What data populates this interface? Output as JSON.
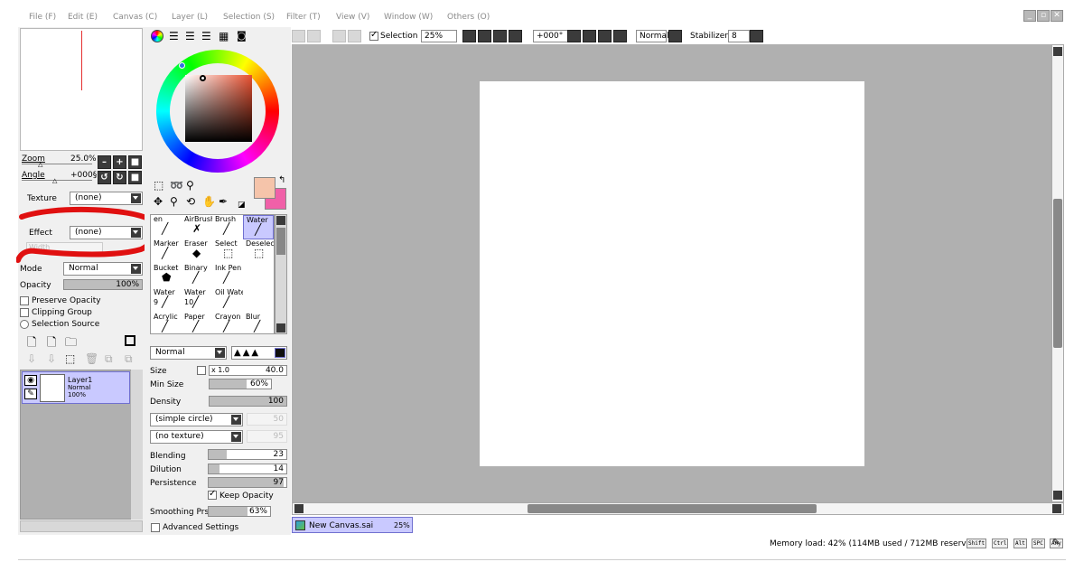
{
  "menu": {
    "file": "File (F)",
    "edit": "Edit (E)",
    "canvas": "Canvas (C)",
    "layer": "Layer (L)",
    "selection": "Selection (S)",
    "filter": "Filter (T)",
    "view": "View (V)",
    "window": "Window (W)",
    "others": "Others (O)"
  },
  "navigator": {
    "zoom_label": "Zoom",
    "zoom_value": "25.0%",
    "angle_label": "Angle",
    "angle_value": "+000§"
  },
  "layer_props": {
    "texture_label": "Texture",
    "texture_value": "(none)",
    "effect_label": "Effect",
    "effect_value": "(none)",
    "effect_sub": "Width",
    "mode_label": "Mode",
    "mode_value": "Normal",
    "opacity_label": "Opacity",
    "opacity_value": "100%",
    "opacity_level": 1.0,
    "preserve_opacity": "Preserve Opacity",
    "clipping_group": "Clipping Group",
    "selection_source": "Selection Source"
  },
  "layers": [
    {
      "name": "Layer1",
      "mode": "Normal",
      "opacity": "100%"
    }
  ],
  "colors": {
    "primary": "#f5c4aa",
    "secondary": "#f060a8",
    "highlight": "#e01010"
  },
  "tools": [
    {
      "name": "Pen",
      "label": "en"
    },
    {
      "name": "AirBrush",
      "label": "AirBrush"
    },
    {
      "name": "Brush",
      "label": "Brush"
    },
    {
      "name": "Water",
      "label": "Water"
    },
    {
      "name": "Marker",
      "label": "Marker"
    },
    {
      "name": "Eraser",
      "label": "Eraser"
    },
    {
      "name": "Select",
      "label": "Select"
    },
    {
      "name": "Deselect",
      "label": "Deselect"
    },
    {
      "name": "Bucket",
      "label": "Bucket"
    },
    {
      "name": "Binary",
      "label": "Binary"
    },
    {
      "name": "InkPen",
      "label": "Ink Pen"
    },
    {
      "name": "Empty",
      "label": ""
    },
    {
      "name": "Water9",
      "label": "Water"
    },
    {
      "name": "Water10",
      "label": "Water"
    },
    {
      "name": "OilWater",
      "label": "Oil Wate"
    },
    {
      "name": "Empty2",
      "label": ""
    },
    {
      "name": "Acrylic",
      "label": "Acrylic"
    },
    {
      "name": "Paper",
      "label": "Paper"
    },
    {
      "name": "Crayon",
      "label": "Crayon"
    },
    {
      "name": "Blur",
      "label": "Blur"
    }
  ],
  "tool_sub": {
    "water9": "9",
    "water10": "10"
  },
  "brush": {
    "blend_mode": "Normal",
    "size_label": "Size",
    "size_mult": "x 1.0",
    "size_value": "40.0",
    "min_size_label": "Min Size",
    "min_size_value": "60%",
    "min_size_level": 0.6,
    "density_label": "Density",
    "density_value": "100",
    "density_level": 1.0,
    "shape": "(simple circle)",
    "shape_value": "50",
    "texture": "(no texture)",
    "texture_value": "95",
    "blending_label": "Blending",
    "blending_value": "23",
    "blending_level": 0.23,
    "dilution_label": "Dilution",
    "dilution_value": "14",
    "dilution_level": 0.14,
    "persistence_label": "Persistence",
    "persistence_value": "97",
    "persistence_level": 0.97,
    "keep_opacity": "Keep Opacity",
    "smoothing_label": "Smoothing Prs",
    "smoothing_value": "63%",
    "smoothing_level": 0.63,
    "advanced": "Advanced Settings"
  },
  "toolbar": {
    "selection": "Selection",
    "zoom": "25%",
    "angle": "+000°",
    "blend": "Normal",
    "stabilizer_label": "Stabilizer",
    "stabilizer_value": "8"
  },
  "document_tab": {
    "name": "New Canvas.sai",
    "zoom": "25%"
  },
  "status": {
    "memory": "Memory load: 42% (114MB used / 712MB reserved)",
    "keys": [
      "Shift",
      "Ctrl",
      "Alt",
      "SPC",
      "Any"
    ]
  }
}
